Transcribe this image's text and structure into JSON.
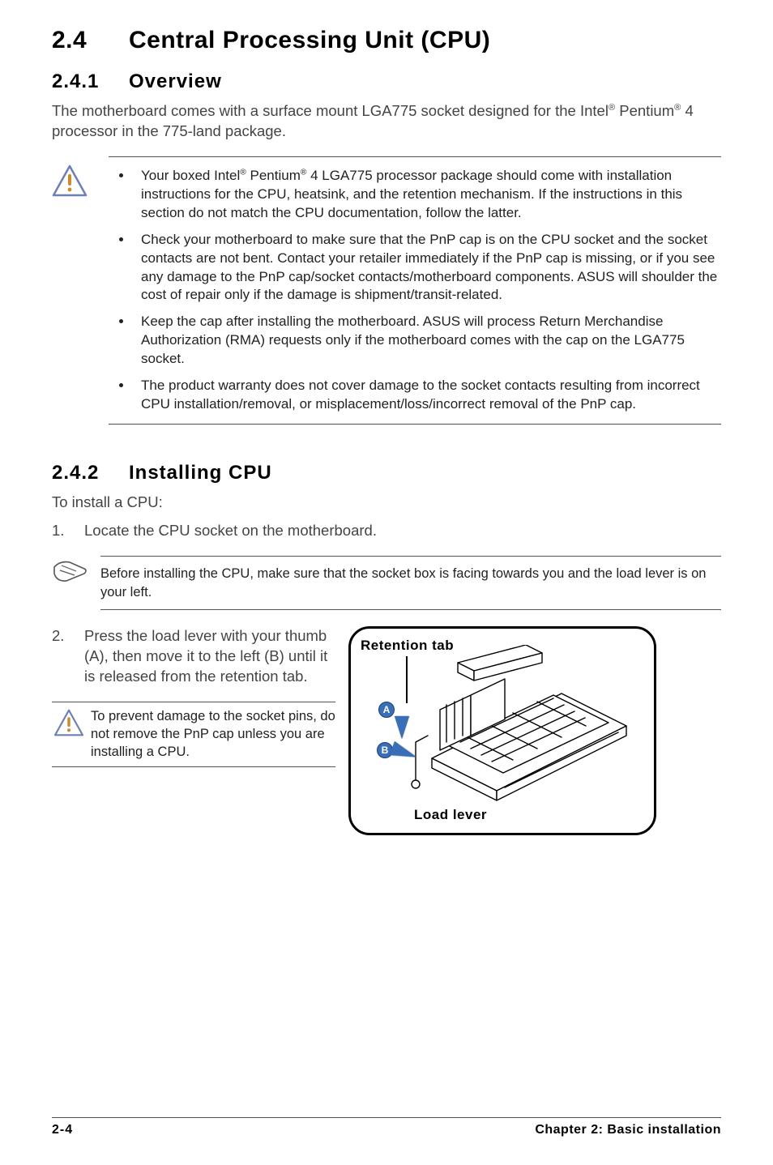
{
  "section": {
    "num": "2.4",
    "title": "Central Processing Unit (CPU)"
  },
  "sub1": {
    "num": "2.4.1",
    "title": "Overview",
    "intro_pre": "The motherboard comes with a surface mount LGA775 socket designed for the Intel",
    "intro_mid": " Pentium",
    "intro_post": " 4 processor in the 775-land package."
  },
  "caution1": {
    "item1_pre": "Your boxed Intel",
    "item1_mid": " Pentium",
    "item1_post": " 4 LGA775 processor package should come with installation instructions for the CPU, heatsink, and the retention mechanism. If the instructions in this section do not match the CPU documentation, follow the latter.",
    "item2": "Check your motherboard to make sure that the PnP cap is on the CPU socket and the socket contacts are not bent. Contact your retailer immediately if the PnP cap is missing, or if you see any damage to the PnP cap/socket contacts/motherboard components. ASUS will shoulder the cost of repair only if the damage is shipment/transit-related.",
    "item3": "Keep the cap after installing the motherboard. ASUS will process Return Merchandise Authorization (RMA) requests only if the motherboard comes with the cap on the LGA775 socket.",
    "item4": "The product warranty does not cover damage to the socket contacts resulting from incorrect CPU installation/removal, or misplacement/loss/incorrect removal of the PnP cap."
  },
  "sub2": {
    "num": "2.4.2",
    "title": "Installing CPU",
    "lead": "To install a CPU:"
  },
  "steps": {
    "s1": {
      "n": "1.",
      "t": "Locate the CPU socket on the motherboard."
    },
    "s2": {
      "n": "2.",
      "t": "Press the load lever with your thumb (A), then move it to the left (B) until it is released from the retention tab."
    }
  },
  "tip": {
    "text": "Before installing the CPU, make sure that the socket box is facing towards you and the load lever is on your left."
  },
  "caution2": {
    "text": "To prevent damage to the socket pins, do not remove the PnP cap unless you are installing a CPU."
  },
  "figure": {
    "top_label": "Retention tab",
    "bottom_label": "Load lever",
    "a": "A",
    "b": "B"
  },
  "footer": {
    "page": "2-4",
    "chapter": "Chapter 2: Basic installation"
  },
  "reg": "®"
}
